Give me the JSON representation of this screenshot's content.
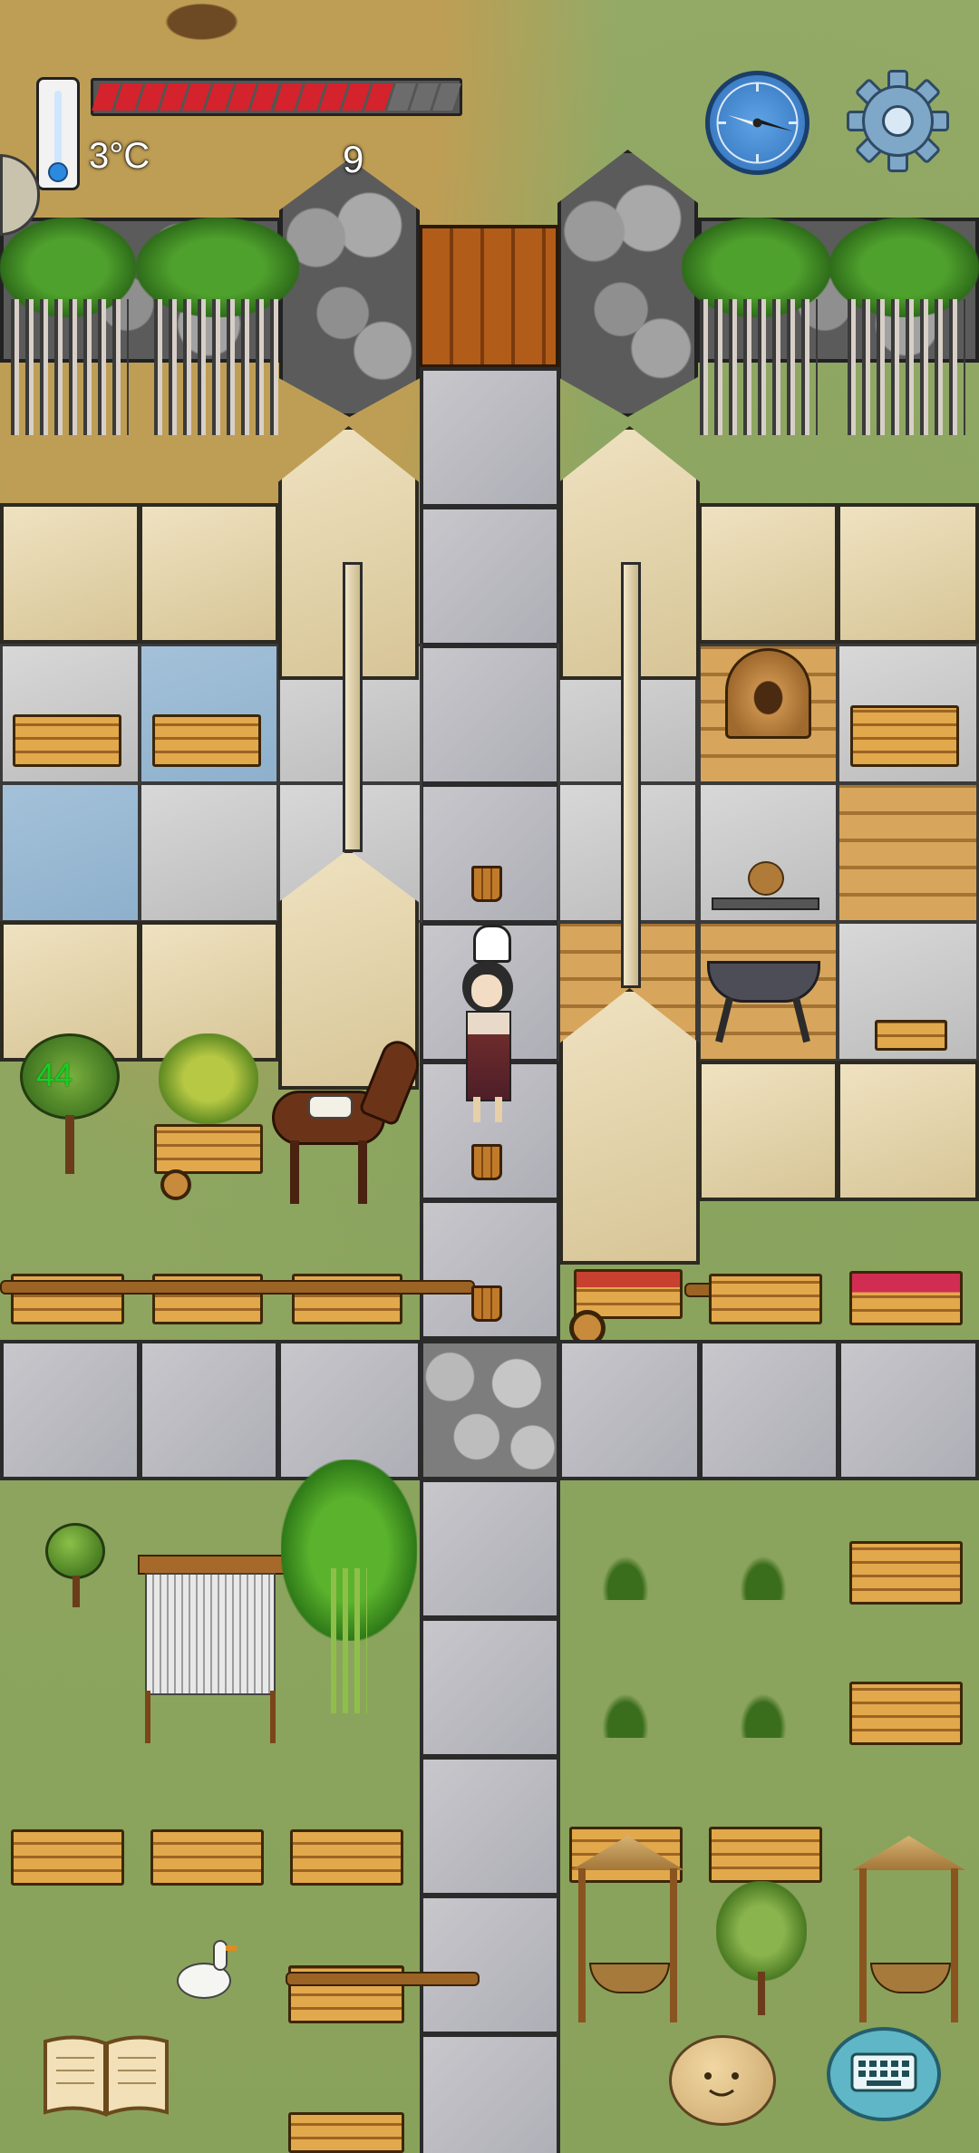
{
  "hud": {
    "temperature": "3°C",
    "food_pips_total": 16,
    "food_pips_filled": 13,
    "yum_count": "9",
    "age_label": "44"
  },
  "icons": {
    "thermometer": "thermometer-icon",
    "compass": "compass-icon",
    "settings": "gear-icon",
    "book": "book-icon",
    "emote": "emote-face-icon",
    "keyboard": "keyboard-icon"
  },
  "colors": {
    "food_fill": "#d4232c",
    "food_empty": "#6c6c6c",
    "age_label": "#19d019"
  }
}
